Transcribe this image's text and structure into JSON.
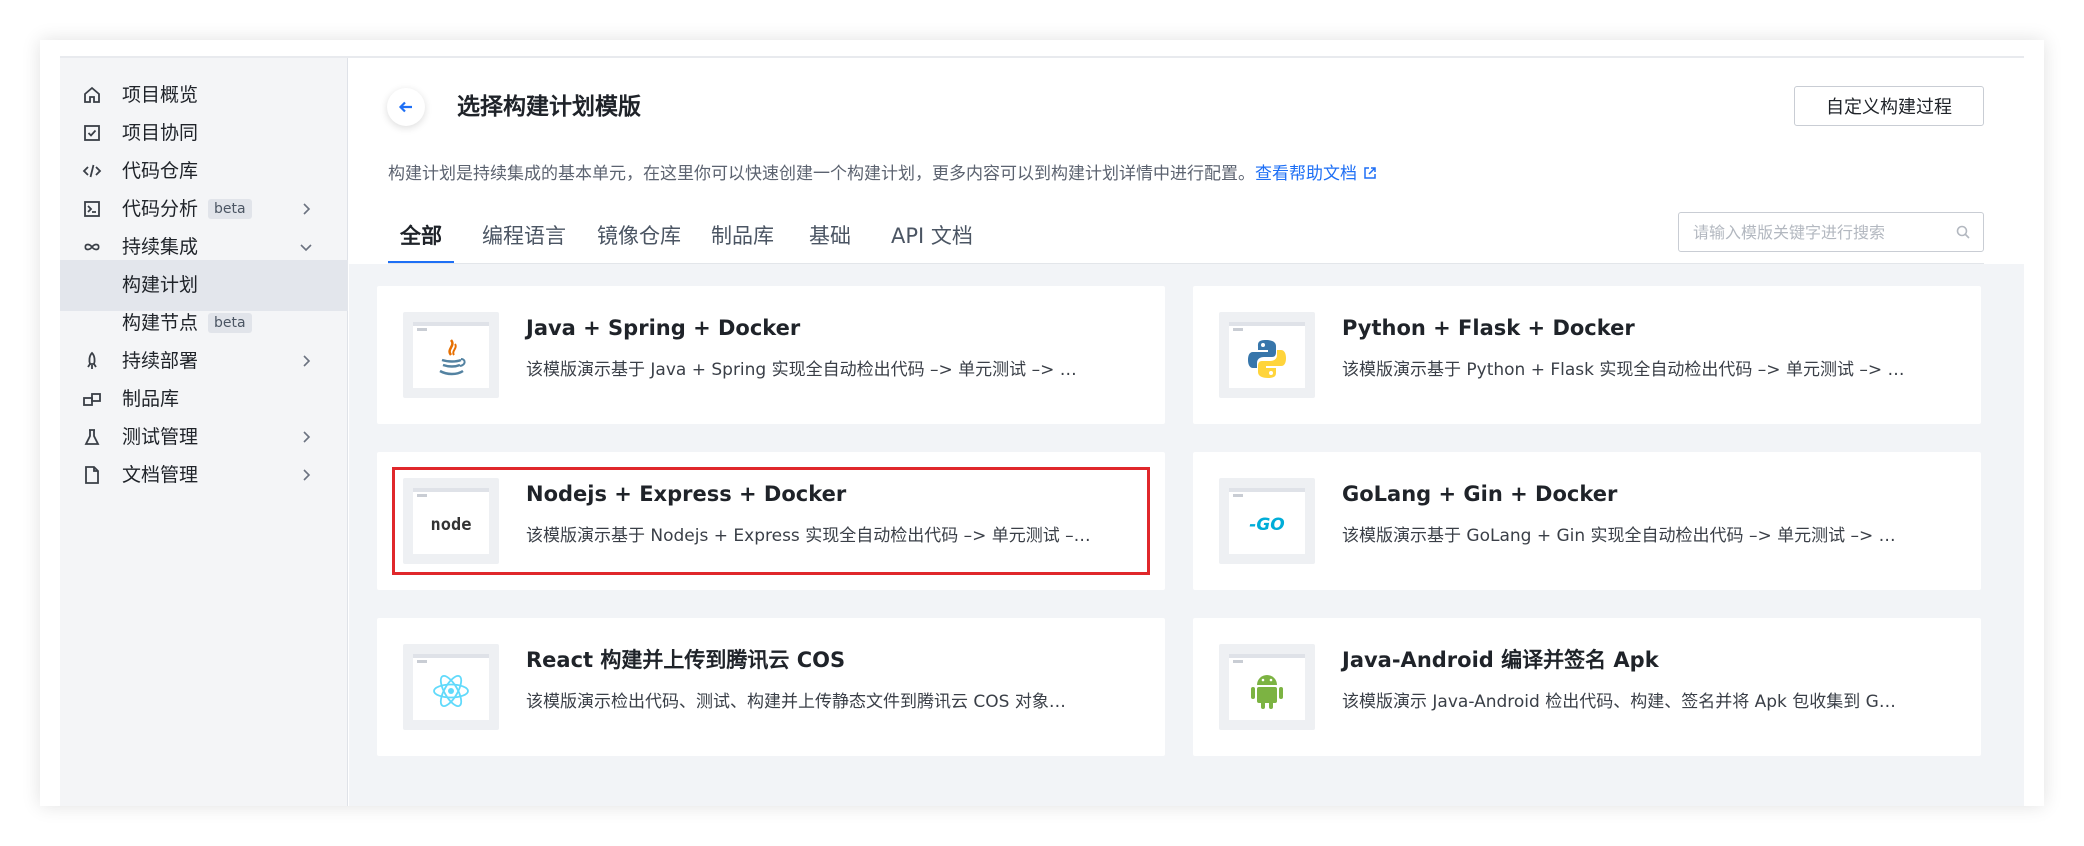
{
  "sidebar": {
    "items": [
      {
        "label": "项目概览",
        "icon": "home-icon"
      },
      {
        "label": "项目协同",
        "icon": "checkbox-icon"
      },
      {
        "label": "代码仓库",
        "icon": "code-icon"
      },
      {
        "label": "代码分析",
        "icon": "terminal-icon",
        "badge": "beta"
      },
      {
        "label": "持续集成",
        "icon": "infinity-icon"
      },
      {
        "label": "构建计划"
      },
      {
        "label": "构建节点",
        "badge": "beta"
      },
      {
        "label": "持续部署",
        "icon": "rocket-icon"
      },
      {
        "label": "制品库",
        "icon": "package-icon"
      },
      {
        "label": "测试管理",
        "icon": "flask-icon"
      },
      {
        "label": "文档管理",
        "icon": "document-icon"
      }
    ]
  },
  "header": {
    "title": "选择构建计划模版",
    "custom_button": "自定义构建过程",
    "description": "构建计划是持续集成的基本单元，在这里你可以快速创建一个构建计划，更多内容可以到构建计划详情中进行配置。",
    "help_link": "查看帮助文档"
  },
  "tabs": [
    "全部",
    "编程语言",
    "镜像仓库",
    "制品库",
    "基础",
    "API 文档"
  ],
  "active_tab": "全部",
  "search": {
    "placeholder": "请输入模版关键字进行搜索"
  },
  "templates": [
    {
      "title": "Java + Spring + Docker",
      "desc": "该模版演示基于 Java + Spring 实现全自动检出代码 –> 单元测试 –> …",
      "logo": "java-icon"
    },
    {
      "title": "Python + Flask + Docker",
      "desc": "该模版演示基于 Python + Flask 实现全自动检出代码 –> 单元测试 –> …",
      "logo": "python-icon"
    },
    {
      "title": "Nodejs + Express + Docker",
      "desc": "该模版演示基于 Nodejs + Express 实现全自动检出代码 –> 单元测试 –…",
      "logo": "nodejs-icon"
    },
    {
      "title": "GoLang + Gin + Docker",
      "desc": "该模版演示基于 GoLang + Gin 实现全自动检出代码 –> 单元测试 –> …",
      "logo": "golang-icon"
    },
    {
      "title": "React 构建并上传到腾讯云 COS",
      "desc": "该模版演示检出代码、测试、构建并上传静态文件到腾讯云 COS 对象…",
      "logo": "react-icon"
    },
    {
      "title": "Java-Android 编译并签名 Apk",
      "desc": "该模版演示 Java-Android 检出代码、构建、签名并将 Apk 包收集到 G…",
      "logo": "android-icon"
    }
  ],
  "logo_texts": {
    "node": "node",
    "go": "GO"
  },
  "colors": {
    "accent": "#1e6ff5",
    "highlight": "#e0272b",
    "java_red": "#e76f00",
    "java_blue": "#5382a1",
    "python_blue": "#3776ab",
    "python_yellow": "#ffd43b",
    "react": "#61dafb",
    "android": "#7cb342",
    "go": "#00add8"
  }
}
